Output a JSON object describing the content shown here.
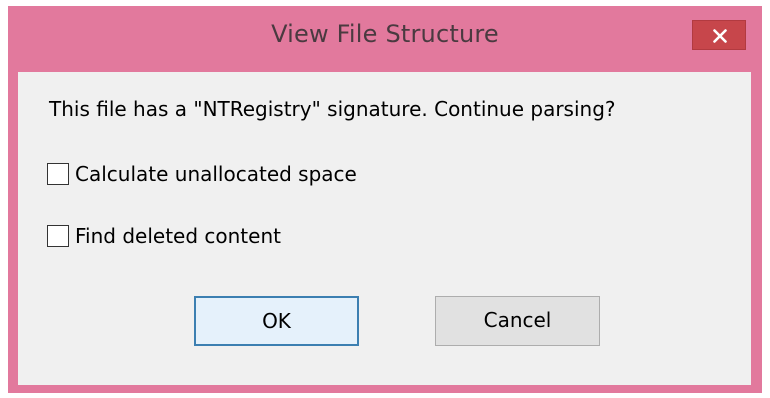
{
  "dialog": {
    "title": "View File Structure",
    "close_icon": "close-icon",
    "message": "This file has a \"NTRegistry\" signature.  Continue parsing?",
    "checkboxes": [
      {
        "label": "Calculate unallocated space",
        "checked": false
      },
      {
        "label": "Find deleted content",
        "checked": false
      }
    ],
    "buttons": {
      "ok": "OK",
      "cancel": "Cancel"
    }
  },
  "colors": {
    "frame": "#e2799d",
    "close_button": "#c7464b",
    "client_background": "#f0f0f0",
    "default_button_border": "#3c7fb1"
  }
}
